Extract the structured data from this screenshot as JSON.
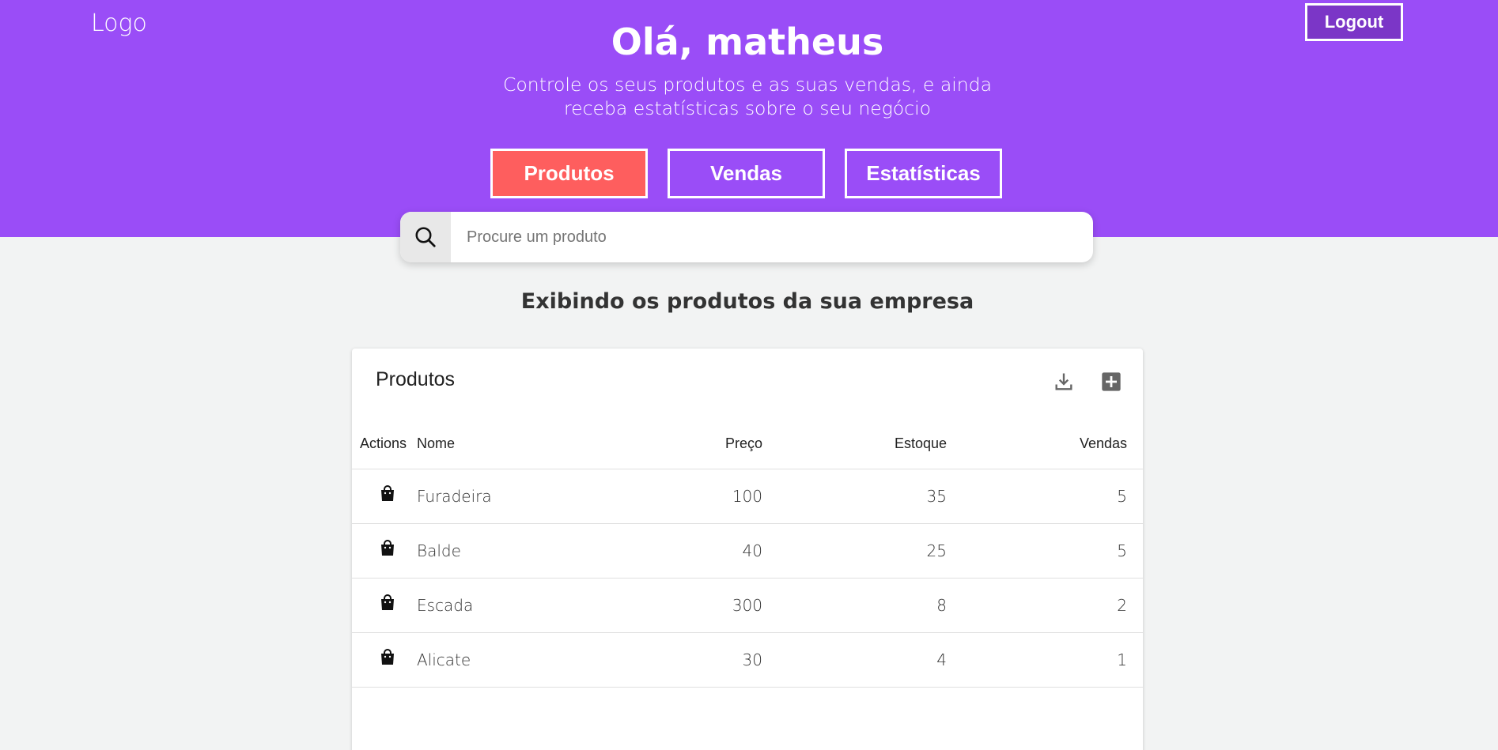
{
  "header": {
    "logo": "Logo",
    "logout_label": "Logout",
    "greeting": "Olá, matheus",
    "subtitle": "Controle os seus produtos e as suas vendas, e ainda receba estatísticas sobre o seu negócio",
    "tabs": [
      {
        "label": "Produtos",
        "active": true
      },
      {
        "label": "Vendas",
        "active": false
      },
      {
        "label": "Estatísticas",
        "active": false
      }
    ]
  },
  "search": {
    "placeholder": "Procure um produto",
    "icon": "search-icon"
  },
  "main": {
    "section_title": "Exibindo os produtos da sua empresa"
  },
  "table": {
    "title": "Produtos",
    "actions": [
      "download-icon",
      "add-box-icon"
    ],
    "columns": [
      "Actions",
      "Nome",
      "Preço",
      "Estoque",
      "Vendas"
    ],
    "rows": [
      {
        "nome": "Furadeira",
        "preco": "100",
        "estoque": "35",
        "vendas": "5"
      },
      {
        "nome": "Balde",
        "preco": "40",
        "estoque": "25",
        "vendas": "5"
      },
      {
        "nome": "Escada",
        "preco": "300",
        "estoque": "8",
        "vendas": "2"
      },
      {
        "nome": "Alicate",
        "preco": "30",
        "estoque": "4",
        "vendas": "1"
      }
    ],
    "row_action_icon": "shopping-bag-icon"
  },
  "colors": {
    "primary": "#9a4df7",
    "active_tab": "#fe5e5e",
    "logout_bg": "#7b36c7",
    "background": "#f2f3f3"
  }
}
